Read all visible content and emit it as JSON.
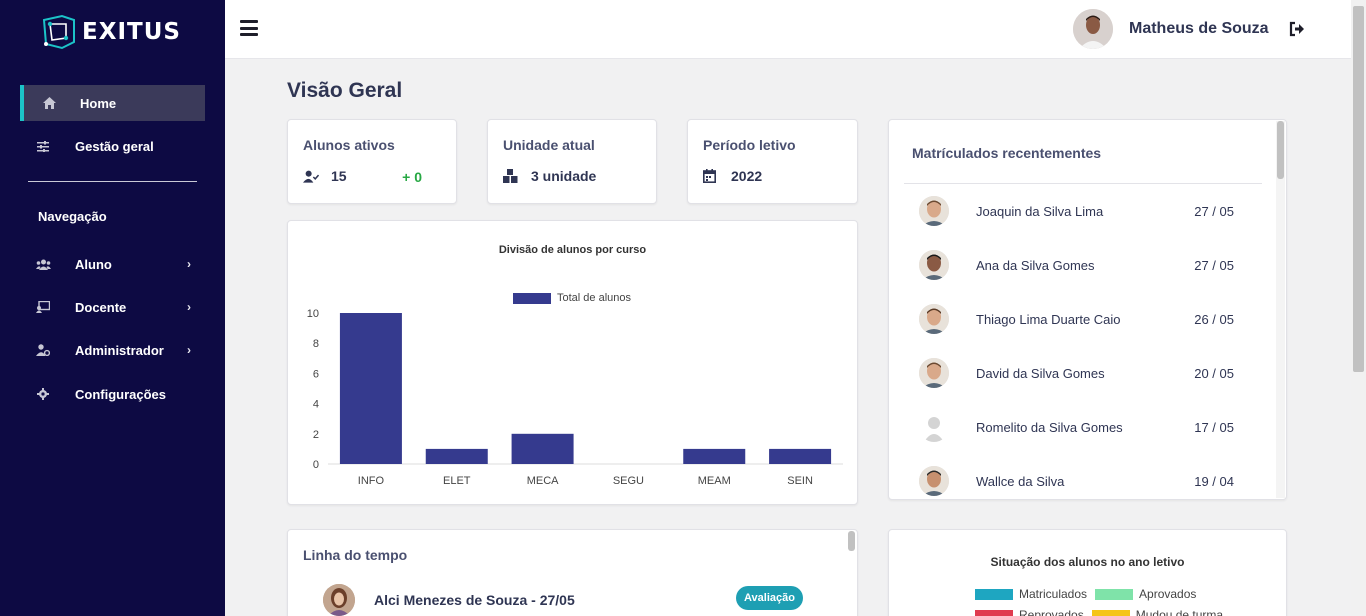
{
  "app": {
    "name": "EXITUS"
  },
  "sidebar": {
    "items": [
      {
        "label": "Home",
        "icon": "home-icon",
        "active": true
      },
      {
        "label": "Gestão geral",
        "icon": "sliders-icon"
      }
    ],
    "nav_heading": "Navegação",
    "nav_items": [
      {
        "label": "Aluno",
        "icon": "users-icon",
        "chevron": "›"
      },
      {
        "label": "Docente",
        "icon": "chalkboard-icon",
        "chevron": "›"
      },
      {
        "label": "Administrador",
        "icon": "user-cog-icon",
        "chevron": "›"
      },
      {
        "label": "Configurações",
        "icon": "gear-icon"
      }
    ]
  },
  "topbar": {
    "user_name": "Matheus de Souza"
  },
  "page": {
    "title": "Visão Geral"
  },
  "stats": [
    {
      "label": "Alunos ativos",
      "value": "15",
      "delta": "+ 0",
      "icon": "user-check-icon"
    },
    {
      "label": "Unidade atual",
      "value": "3 unidade",
      "icon": "boxes-icon"
    },
    {
      "label": "Período letivo",
      "value": "2022",
      "icon": "calendar-icon"
    }
  ],
  "chart_data": {
    "type": "bar",
    "title": "Divisão de alunos por curso",
    "categories": [
      "INFO",
      "ELET",
      "MECA",
      "SEGU",
      "MEAM",
      "SEIN"
    ],
    "series": [
      {
        "name": "Total de alunos",
        "values": [
          10,
          1,
          2,
          0,
          1,
          1
        ],
        "color": "#353a8e"
      }
    ],
    "ylim": [
      0,
      10
    ],
    "yticks": [
      0,
      2,
      4,
      6,
      8,
      10
    ],
    "legend": "top"
  },
  "recent": {
    "title": "Matrículados recentementes",
    "rows": [
      {
        "name": "Joaquin da Silva Lima",
        "date": "27 / 05"
      },
      {
        "name": "Ana da Silva Gomes",
        "date": "27 / 05"
      },
      {
        "name": "Thiago Lima Duarte Caio",
        "date": "26 / 05"
      },
      {
        "name": "David da Silva Gomes",
        "date": "20 / 05"
      },
      {
        "name": "Romelito da Silva Gomes",
        "date": "17 / 05"
      },
      {
        "name": "Wallce da Silva",
        "date": "19 / 04"
      }
    ]
  },
  "timeline": {
    "title": "Linha do tempo",
    "entry": {
      "name": "Alci Menezes de Souza - 27/05",
      "badge": "Avaliação"
    }
  },
  "situation": {
    "title": "Situação dos alunos no ano letivo",
    "legend": [
      {
        "label": "Matriculados",
        "color": "#1ea6c1"
      },
      {
        "label": "Aprovados",
        "color": "#7fe3a9"
      },
      {
        "label": "Reprovados",
        "color": "#e03b4f"
      },
      {
        "label": "Mudou de turma",
        "color": "#f5c518"
      }
    ]
  }
}
